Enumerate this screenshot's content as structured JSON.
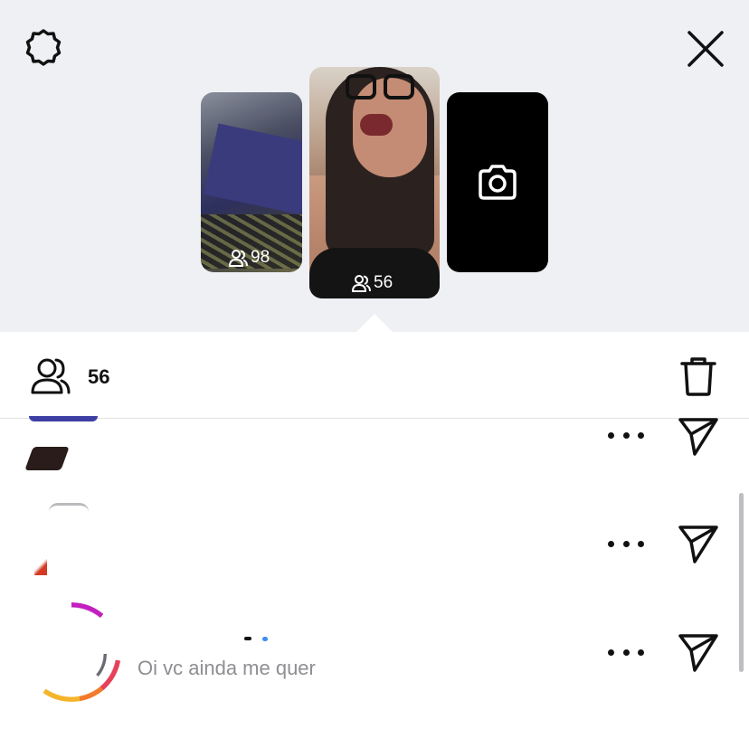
{
  "top": {
    "settings_icon": "gear-icon",
    "close_icon": "close-icon"
  },
  "stories": [
    {
      "viewers": "98"
    },
    {
      "viewers": "56"
    },
    {
      "icon": "camera-icon"
    }
  ],
  "header": {
    "viewer_count": "56",
    "viewers_icon": "people-icon",
    "delete_icon": "trash-icon"
  },
  "viewers_list": [
    {
      "message": ""
    },
    {
      "message": ""
    },
    {
      "message": "Oi vc ainda me quer"
    }
  ],
  "colors": {
    "panel_bg": "#eff0f4",
    "text": "#111111",
    "secondary_text": "#8e8e93"
  }
}
